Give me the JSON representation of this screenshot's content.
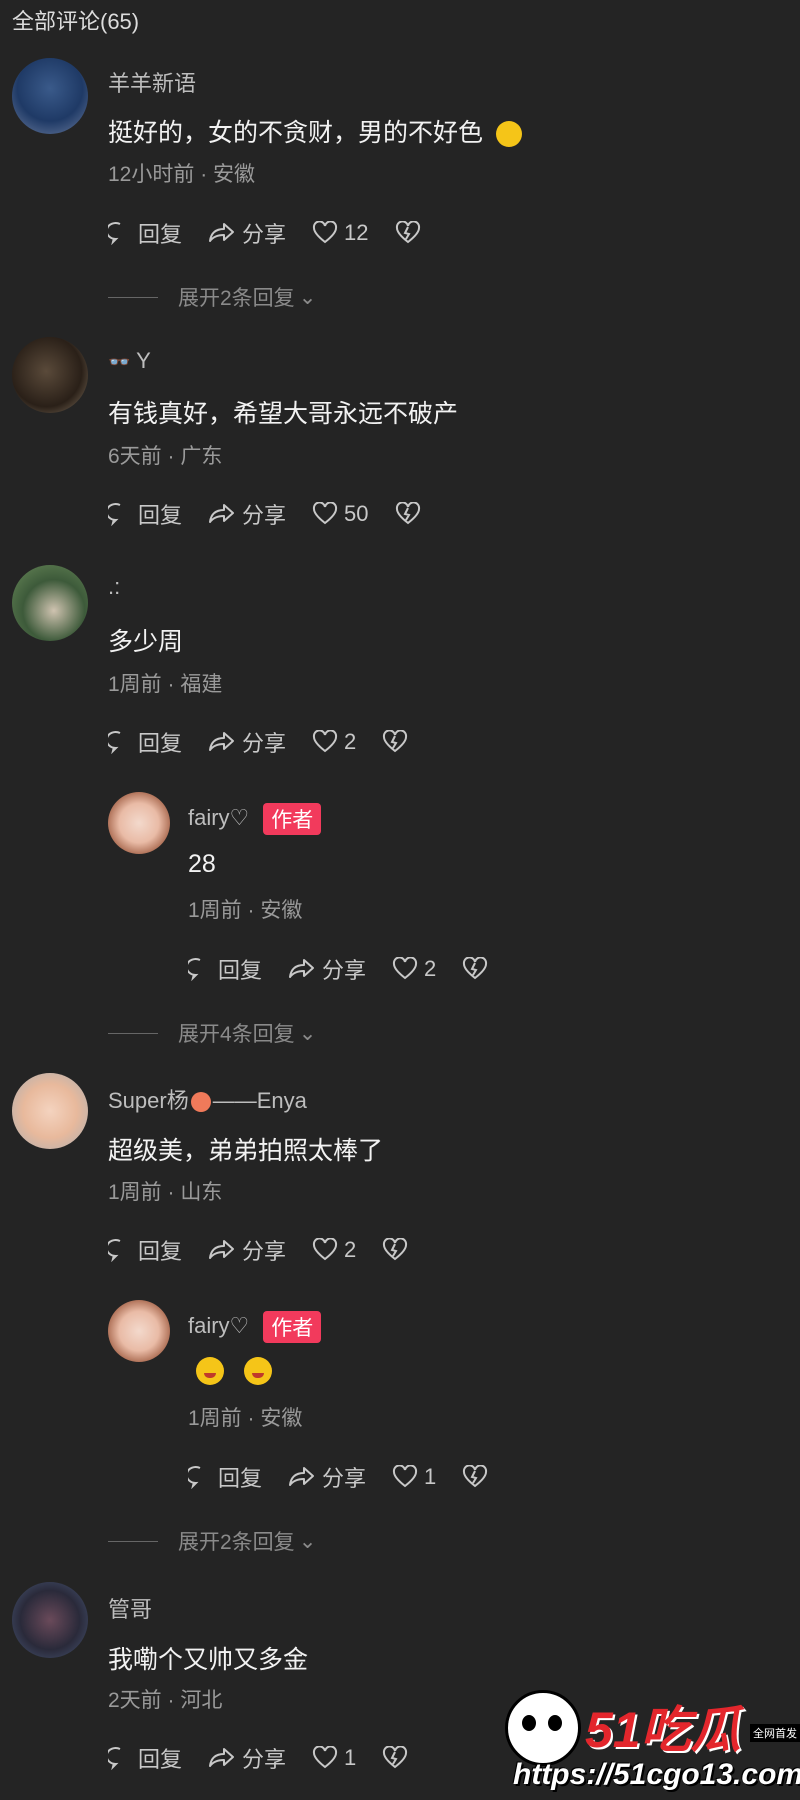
{
  "header": {
    "title": "全部评论(65)"
  },
  "actions": {
    "reply": "回复",
    "share": "分享"
  },
  "author_tag": "作者",
  "comments": [
    {
      "user": "羊羊新语",
      "text": "挺好的，女的不贪财，男的不好色",
      "time": "12小时前",
      "loc": "安徽",
      "likes": "12",
      "expand": "展开2条回复"
    },
    {
      "user": "Y",
      "text": "有钱真好，希望大哥永远不破产",
      "time": "6天前",
      "loc": "广东",
      "likes": "50"
    },
    {
      "user": ".:",
      "text": "多少周",
      "time": "1周前",
      "loc": "福建",
      "likes": "2",
      "reply": {
        "user": "fairy♡",
        "text": "28",
        "time": "1周前",
        "loc": "安徽",
        "likes": "2"
      },
      "expand": "展开4条回复"
    },
    {
      "user": "Super杨",
      "user_suffix": "——Enya",
      "text": "超级美，弟弟拍照太棒了",
      "time": "1周前",
      "loc": "山东",
      "likes": "2",
      "reply": {
        "user": "fairy♡",
        "time": "1周前",
        "loc": "安徽",
        "likes": "1"
      },
      "expand": "展开2条回复"
    },
    {
      "user": "管哥",
      "text": "我嘞个又帅又多金",
      "time": "2天前",
      "loc": "河北",
      "likes": "1"
    }
  ],
  "watermark": {
    "logo": "51吃瓜",
    "url": "https://51cgo13.com",
    "tagline": "全网首发"
  },
  "colors": {
    "background": "#242424",
    "author_tag": "#f23a5c",
    "meta": "#9a9a9a"
  }
}
